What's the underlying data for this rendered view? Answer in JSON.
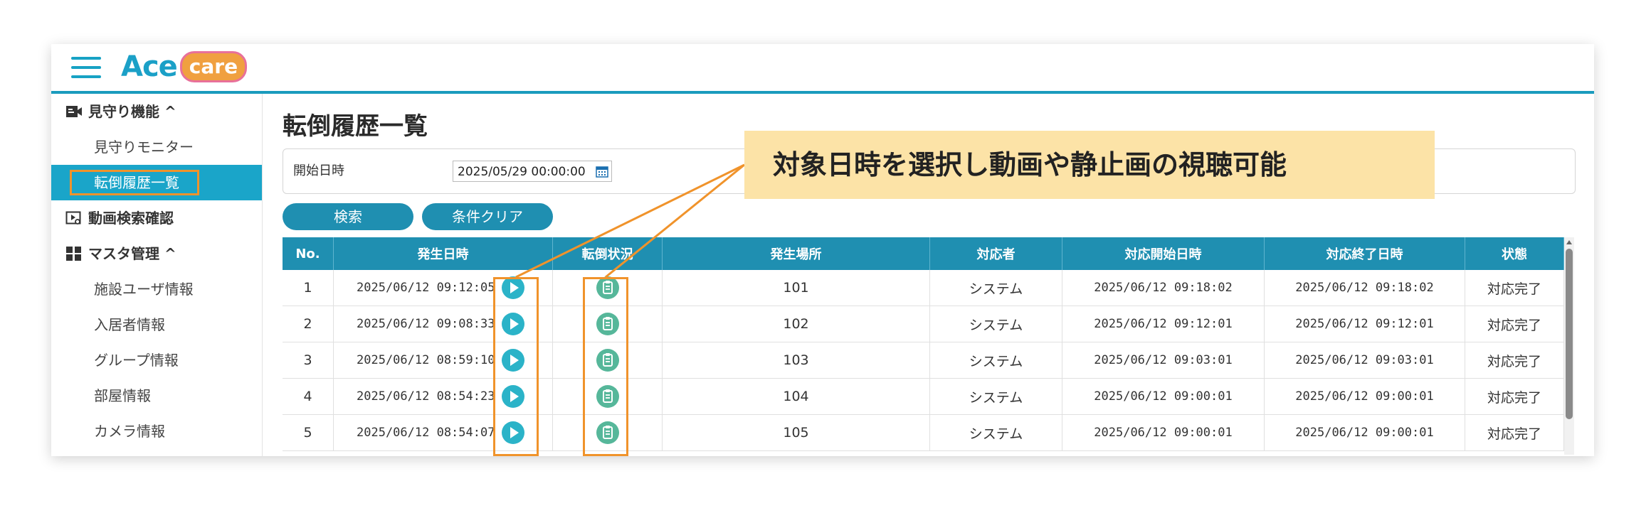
{
  "app": {
    "logo_ace": "Ace",
    "logo_care": "care"
  },
  "sidebar": {
    "sections": [
      {
        "label": "見守り機能 ^",
        "icon": "camera-icon",
        "items": [
          "見守りモニター",
          "転倒履歴一覧"
        ]
      },
      {
        "label": "動画検索確認",
        "icon": "video-search-icon",
        "items": []
      },
      {
        "label": "マスタ管理 ^",
        "icon": "grid-icon",
        "items": [
          "施設ユーザ情報",
          "入居者情報",
          "グループ情報",
          "部屋情報",
          "カメラ情報"
        ]
      }
    ],
    "active_item": "転倒履歴一覧"
  },
  "page": {
    "title": "転倒履歴一覧"
  },
  "filter": {
    "label": "開始日時",
    "value": "2025/05/29 00:00:00"
  },
  "buttons": {
    "search": "検索",
    "clear": "条件クリア"
  },
  "table": {
    "columns": [
      "No.",
      "発生日時",
      "転倒状況",
      "発生場所",
      "対応者",
      "対応開始日時",
      "対応終了日時",
      "状態"
    ],
    "rows": [
      {
        "no": "1",
        "datetime": "2025/06/12 09:12:05",
        "place": "101",
        "responder": "システム",
        "start": "2025/06/12 09:18:02",
        "end": "2025/06/12 09:18:02",
        "status": "対応完了"
      },
      {
        "no": "2",
        "datetime": "2025/06/12 09:08:33",
        "place": "102",
        "responder": "システム",
        "start": "2025/06/12 09:12:01",
        "end": "2025/06/12 09:12:01",
        "status": "対応完了"
      },
      {
        "no": "3",
        "datetime": "2025/06/12 08:59:10",
        "place": "103",
        "responder": "システム",
        "start": "2025/06/12 09:03:01",
        "end": "2025/06/12 09:03:01",
        "status": "対応完了"
      },
      {
        "no": "4",
        "datetime": "2025/06/12 08:54:23",
        "place": "104",
        "responder": "システム",
        "start": "2025/06/12 09:00:01",
        "end": "2025/06/12 09:00:01",
        "status": "対応完了"
      },
      {
        "no": "5",
        "datetime": "2025/06/12 08:54:07",
        "place": "105",
        "responder": "システム",
        "start": "2025/06/12 09:00:01",
        "end": "2025/06/12 09:00:01",
        "status": "対応完了"
      }
    ]
  },
  "callout": {
    "text": "対象日時を選択し動画や静止画の視聴可能"
  },
  "colors": {
    "brand": "#1a9bbd",
    "header": "#1f8fb1",
    "highlight": "#f0932b",
    "callout_bg": "#fce3a7",
    "play": "#2bb3c8",
    "clipboard": "#56b79a"
  }
}
